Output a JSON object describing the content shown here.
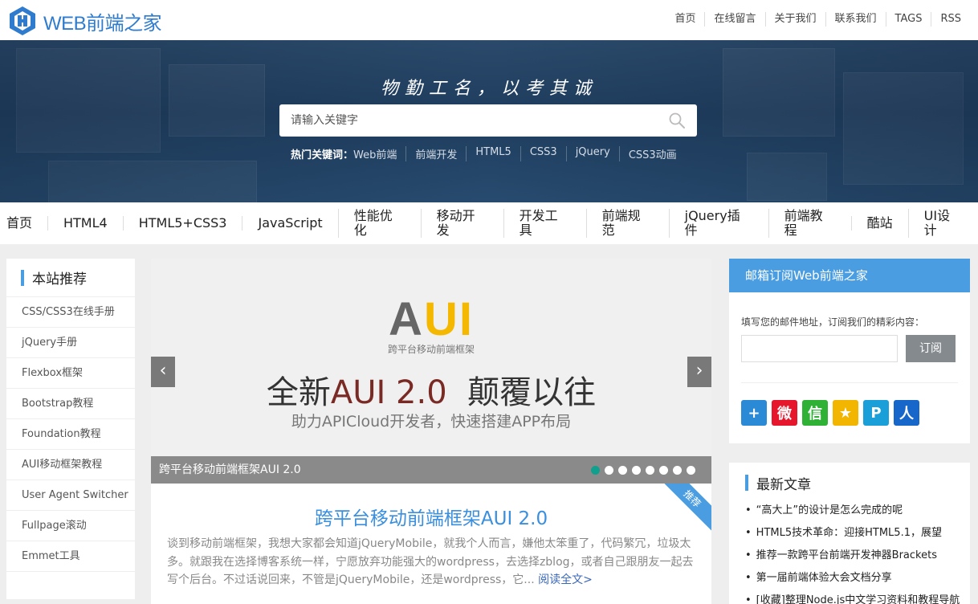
{
  "brand": {
    "logo_en": "WEB",
    "logo_cn": "前端之家",
    "logo_icon": "hexagon-logo-icon",
    "accent": "#2f7ccf"
  },
  "topnav": [
    "首页",
    "在线留言",
    "关于我们",
    "联系我们",
    "TAGS",
    "RSS"
  ],
  "banner": {
    "slogan": "物勤工名，以考其诚",
    "search_placeholder": "请输入关键字",
    "hot_label": "热门关键词：",
    "hot_words": [
      "Web前端",
      "前端开发",
      "HTML5",
      "CSS3",
      "jQuery",
      "CSS3动画"
    ]
  },
  "mainnav": [
    "首页",
    "HTML4",
    "HTML5+CSS3",
    "JavaScript",
    "性能优化",
    "移动开发",
    "开发工具",
    "前端规范",
    "jQuery插件",
    "前端教程",
    "酷站",
    "UI设计"
  ],
  "sidebar": {
    "title": "本站推荐",
    "items": [
      "CSS/CSS3在线手册",
      "jQuery手册",
      "Flexbox框架",
      "Bootstrap教程",
      "Foundation教程",
      "AUI移动框架教程",
      "User Agent Switcher",
      "Fullpage滚动",
      "Emmet工具"
    ]
  },
  "slider": {
    "logo_a": "A",
    "logo_ui": "UI",
    "logo_sub": "跨平台移动前端框架",
    "headline_pre": "全新",
    "headline_red": "AUI 2.0",
    "headline_post": "颠覆以往",
    "tagline": "助力APICloud开发者，快速搭建APP布局",
    "caption": "跨平台移动前端框架AUI 2.0",
    "prev": "‹",
    "next": "›",
    "dot_count": 8,
    "active_dot": 1
  },
  "article": {
    "badge": "推荐",
    "title": "跨平台移动前端框架AUI 2.0",
    "excerpt": "谈到移动前端框架，我想大家都会知道jQueryMobile，就我个人而言，嫌他太笨重了，代码繁冗，垃圾太多。就跟我在选择博客系统一样，宁愿放弃功能强大的wordpress，去选择zblog，或者自己跟朋友一起去写个后台。不过话说回来，不管是jQueryMobile，还是wordpress，它...",
    "read_more": "阅读全文>"
  },
  "subscribe": {
    "title": "邮箱订阅Web前端之家",
    "desc": "填写您的邮件地址，订阅我们的精彩内容：",
    "button": "订阅",
    "shares": [
      {
        "icon": "plus-share-icon",
        "color": "#2a8ad6",
        "glyph": "+"
      },
      {
        "icon": "weibo-share-icon",
        "color": "#e6162d",
        "glyph": "微"
      },
      {
        "icon": "wechat-share-icon",
        "color": "#2eb135",
        "glyph": "信"
      },
      {
        "icon": "qzone-share-icon",
        "color": "#f3b600",
        "glyph": "★"
      },
      {
        "icon": "tencent-weibo-share-icon",
        "color": "#1b9fd9",
        "glyph": "P"
      },
      {
        "icon": "renren-share-icon",
        "color": "#1667c9",
        "glyph": "人"
      }
    ]
  },
  "latest": {
    "title": "最新文章",
    "items": [
      "“高大上”的设计是怎么完成的呢",
      "HTML5技术革命：迎接HTML5.1，展望",
      "推荐一款跨平台前端开发神器Brackets",
      "第一届前端体验大会文档分享",
      "[收藏]整理Node.js中文学习资料和教程导航"
    ]
  }
}
